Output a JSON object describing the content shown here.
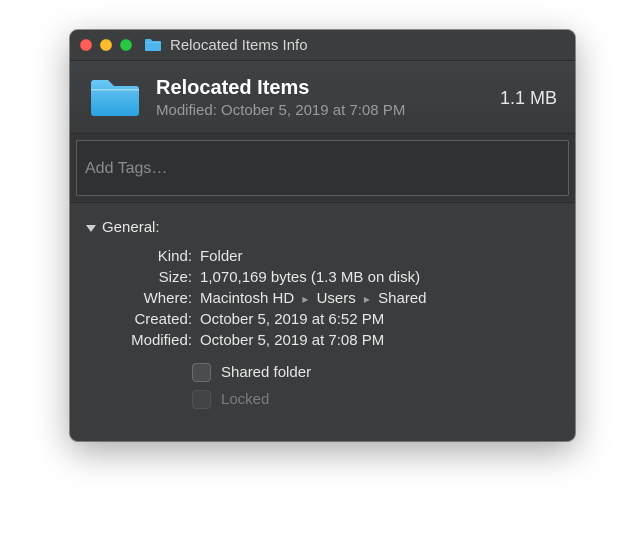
{
  "window": {
    "title": "Relocated Items Info"
  },
  "header": {
    "name": "Relocated Items",
    "size": "1.1 MB",
    "modified_summary": "Modified: October 5, 2019 at 7:08 PM"
  },
  "tags": {
    "placeholder": "Add Tags…",
    "value": ""
  },
  "general": {
    "label": "General:",
    "rows": {
      "kind": {
        "label": "Kind:",
        "value": "Folder"
      },
      "size": {
        "label": "Size:",
        "value": "1,070,169 bytes (1.3 MB on disk)"
      },
      "where": {
        "label": "Where:",
        "path": [
          "Macintosh HD",
          "Users",
          "Shared"
        ]
      },
      "created": {
        "label": "Created:",
        "value": "October 5, 2019 at 6:52 PM"
      },
      "modified": {
        "label": "Modified:",
        "value": "October 5, 2019 at 7:08 PM"
      }
    },
    "checkboxes": {
      "shared": {
        "label": "Shared folder",
        "checked": false
      },
      "locked": {
        "label": "Locked",
        "checked": false,
        "disabled": true
      }
    }
  }
}
